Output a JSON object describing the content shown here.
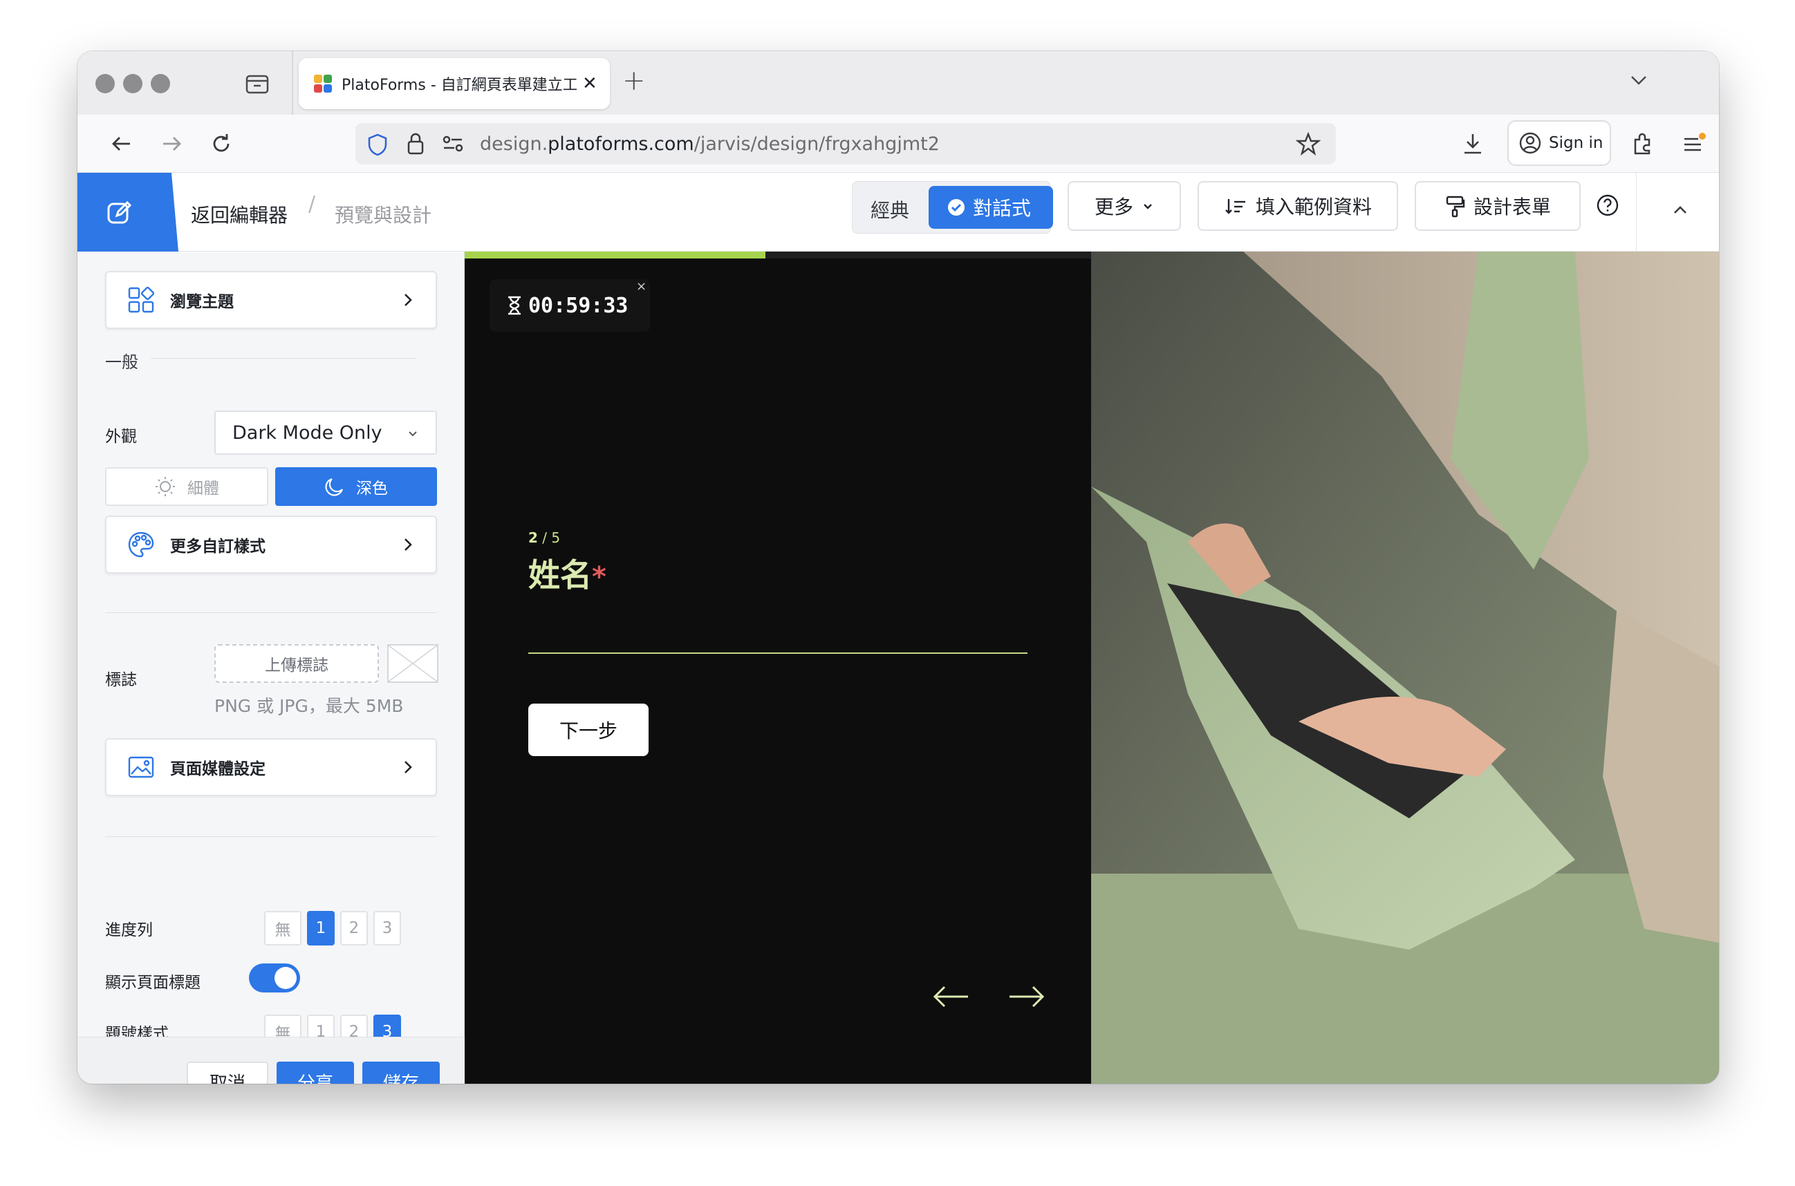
{
  "browser": {
    "tab": {
      "title": "PlatoForms - 自訂網頁表單建立工具"
    },
    "url": {
      "prefix": "design.",
      "host": "platoforms.com",
      "path": "/jarvis/design/frgxahgjmt2"
    },
    "signin_label": "Sign in",
    "favicon_colors": [
      "#f2b233",
      "#3fa34d",
      "#e04848",
      "#2d77e6"
    ]
  },
  "header": {
    "back_label": "返回編輯器",
    "breadcrumb_sep": "/",
    "breadcrumb_current": "預覽與設計",
    "mode_classic": "經典",
    "mode_chat": "對話式",
    "more_label": "更多",
    "fill_sample_label": "填入範例資料",
    "design_form_label": "設計表單"
  },
  "sidebar": {
    "browse_themes": "瀏覽主題",
    "section_general": "一般",
    "appearance_label": "外觀",
    "appearance_value": "Dark Mode Only",
    "theme_light": "細體",
    "theme_dark": "深色",
    "more_custom_styles": "更多自訂樣式",
    "logo_label": "標誌",
    "upload_logo": "上傳標誌",
    "upload_hint": "PNG 或 JPG，最大 5MB",
    "page_media": "頁面媒體設定",
    "progress_bar_label": "進度列",
    "progress_bar_options": [
      "無",
      "1",
      "2",
      "3"
    ],
    "progress_bar_selected": "1",
    "show_title_label": "顯示頁面標題",
    "show_title_on": true,
    "number_style_label": "題號樣式",
    "number_style_options": [
      "無",
      "1",
      "2",
      "3"
    ],
    "number_style_selected": "3",
    "cancel_label": "取消",
    "share_label": "分享",
    "save_label": "儲存"
  },
  "preview": {
    "progress_fraction": 0.48,
    "timer": "00:59:33",
    "timer_close": "×",
    "question_current": "2",
    "question_total": "/ 5",
    "question_title": "姓名",
    "required_mark": "*",
    "next_label": "下一步",
    "accent": "#a6d44d"
  },
  "colors": {
    "brand": "#2d77e6"
  }
}
